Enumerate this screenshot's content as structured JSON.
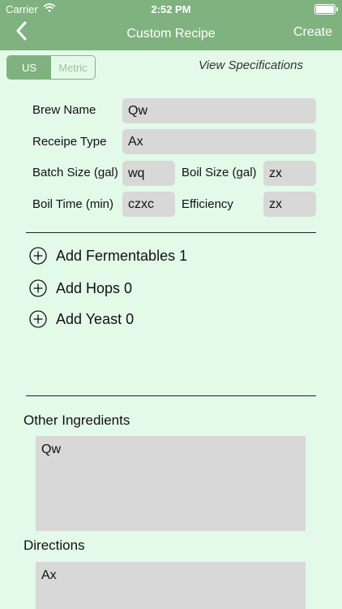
{
  "status": {
    "carrier": "Carrier",
    "time": "2:52 PM"
  },
  "nav": {
    "title": "Custom Recipe",
    "create": "Create"
  },
  "units": {
    "us": "US",
    "metric": "Metric"
  },
  "view_specs": "View Specifications",
  "form": {
    "brew_name_label": "Brew Name",
    "brew_name_value": "Qw",
    "recipe_type_label": "Receipe Type",
    "recipe_type_value": "Ax",
    "batch_size_label": "Batch Size  (gal)",
    "batch_size_value": "wq",
    "boil_size_label": "Boil Size  (gal)",
    "boil_size_value": "zx",
    "boil_time_label": "Boil Time (min)",
    "boil_time_value": "czxc",
    "efficiency_label": "Efficiency",
    "efficiency_value": "zx"
  },
  "add": {
    "fermentables": "Add Fermentables 1",
    "hops": "Add Hops 0",
    "yeast": "Add Yeast 0"
  },
  "other": {
    "label": "Other Ingredients",
    "value": "Qw"
  },
  "directions": {
    "label": "Directions",
    "value": "Ax"
  },
  "colors": {
    "header": "#7fb27f",
    "background": "#e3fae9",
    "field": "#d8d8d8"
  }
}
